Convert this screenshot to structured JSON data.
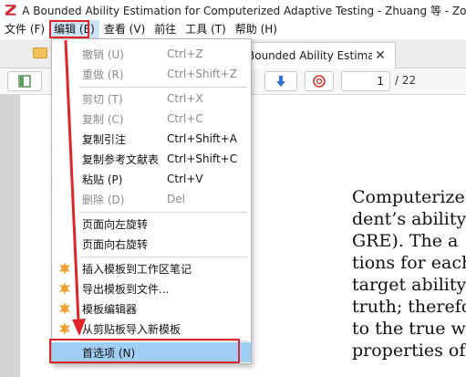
{
  "window": {
    "title": "A Bounded Ability Estimation for Computerized Adaptive Testing - Zhuang 等 - Zotero"
  },
  "menubar": {
    "items": [
      {
        "label": "文件 (F)"
      },
      {
        "label": "编辑 (E)"
      },
      {
        "label": "查看 (V)"
      },
      {
        "label": "前往"
      },
      {
        "label": "工具 (T)"
      },
      {
        "label": "帮助 (H)"
      }
    ]
  },
  "tabs": {
    "active_label": "Bounded Ability Estima...",
    "close_symbol": "✕"
  },
  "toolbar": {
    "page_value": "1",
    "page_total": "/ 22"
  },
  "edit_menu": {
    "undo": {
      "label": "撤销 (U)",
      "shortcut": "Ctrl+Z"
    },
    "redo": {
      "label": "重做 (R)",
      "shortcut": "Ctrl+Shift+Z"
    },
    "cut": {
      "label": "剪切 (T)",
      "shortcut": "Ctrl+X"
    },
    "copy": {
      "label": "复制 (C)",
      "shortcut": "Ctrl+C"
    },
    "copy_citation": {
      "label": "复制引注",
      "shortcut": "Ctrl+Shift+A"
    },
    "copy_bibliography": {
      "label": "复制参考文献表",
      "shortcut": "Ctrl+Shift+C"
    },
    "paste": {
      "label": "粘贴 (P)",
      "shortcut": "Ctrl+V"
    },
    "delete": {
      "label": "删除 (D)",
      "shortcut": "Del"
    },
    "rotate_left": {
      "label": "页面向左旋转"
    },
    "rotate_right": {
      "label": "页面向右旋转"
    },
    "insert_template": {
      "label": "插入模板到工作区笔记"
    },
    "export_template": {
      "label": "导出模板到文件..."
    },
    "template_editor": {
      "label": "模板编辑器"
    },
    "import_template": {
      "label": "从剪贴板导入新模板"
    },
    "preferences": {
      "label": "首选项 (N)"
    }
  },
  "document": {
    "lines": [
      "Computerize",
      "dent’s ability",
      "GRE). The a",
      "tions for each",
      "target ability",
      "truth; therefo",
      "to the true w",
      "properties of"
    ]
  },
  "colors": {
    "annotation": "#e0252a",
    "menu_highlight": "#9fcdf4",
    "plugin_icon": "#f0a030"
  }
}
